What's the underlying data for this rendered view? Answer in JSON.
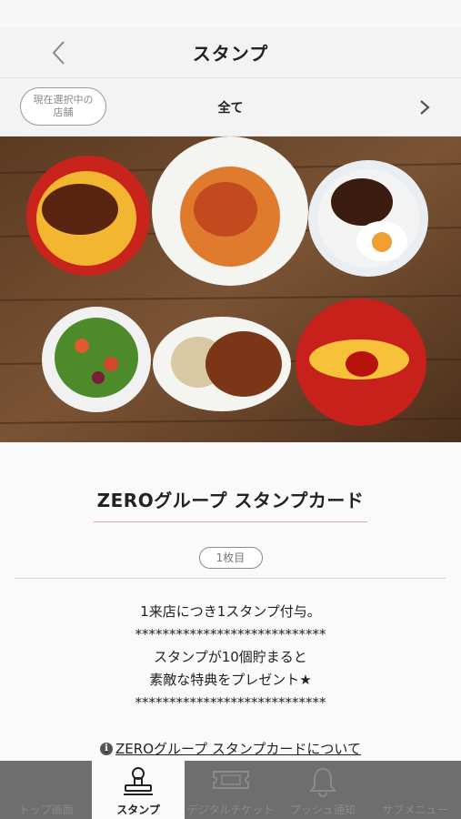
{
  "header": {
    "title": "スタンプ",
    "back_icon": "chevron-left-icon"
  },
  "store_selector": {
    "label": "現在選択中の\n店舗",
    "value": "全て",
    "next_icon": "chevron-right-icon"
  },
  "card": {
    "title": "ZEROグループ スタンプカード",
    "count_label": "1枚目",
    "description": [
      "1来店につき1スタンプ付与。",
      "****************************",
      "スタンプが10個貯まると",
      "素敵な特典をプレゼント★",
      "****************************"
    ],
    "about_link": "ZEROグループ スタンプカードについて"
  },
  "tabs": [
    {
      "label": "トップ画面",
      "icon": "home-icon",
      "active": false
    },
    {
      "label": "スタンプ",
      "icon": "stamp-icon",
      "active": true
    },
    {
      "label": "デジタルチケット",
      "icon": "ticket-icon",
      "active": false
    },
    {
      "label": "プッシュ通知",
      "icon": "bell-icon",
      "active": false
    },
    {
      "label": "サブメニュー",
      "icon": "menu-icon",
      "active": false
    }
  ],
  "colors": {
    "accent_underline": "#e8a2a2",
    "tab_bar": "#6e6e6e"
  }
}
